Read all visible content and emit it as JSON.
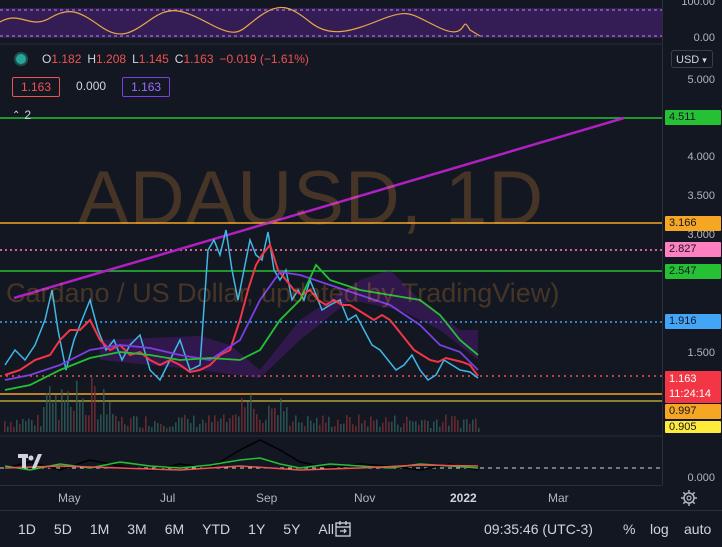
{
  "watermark": {
    "symbol": "ADAUSD, 1D",
    "description": "Cardano / US Dollar, updated by TradingView)"
  },
  "ohlc": {
    "open_label": "O",
    "open": "1.182",
    "high_label": "H",
    "high": "1.208",
    "low_label": "L",
    "low": "1.145",
    "close_label": "C",
    "close": "1.163",
    "change": "−0.019 (−1.61%)"
  },
  "indicator_boxes": [
    "1.163",
    "0.000",
    "1.163"
  ],
  "collapse": {
    "count": "2"
  },
  "currency": {
    "label": "USD"
  },
  "price_axis": {
    "ticks": [
      "5.000",
      "4.000",
      "3.500",
      "3.000",
      "1.500",
      "0.000"
    ],
    "osc_ticks": [
      "100.00",
      "0.00"
    ],
    "tags": {
      "t4511": "4.511",
      "t3166": "3.166",
      "t2827": "2.827",
      "t2547": "2.547",
      "t1916": "1.916",
      "t1163": "1.163",
      "countdown": "11:24:14",
      "t0997": "0.997",
      "t0905": "0.905"
    }
  },
  "date_axis": [
    "May",
    "Jul",
    "Sep",
    "Nov",
    "2022",
    "Mar"
  ],
  "ranges": [
    "1D",
    "5D",
    "1M",
    "3M",
    "6M",
    "YTD",
    "1Y",
    "5Y",
    "All"
  ],
  "footer": {
    "clock": "09:35:46 (UTC-3)",
    "percent": "%",
    "log": "log",
    "auto": "auto"
  },
  "logo": "TV",
  "colors": {
    "green": "#26c034",
    "orange": "#f5a623",
    "pink": "#ff80c0",
    "blue": "#42a5f5",
    "red": "#ef5350",
    "purple": "#9c27b0",
    "yellow": "#ffeb3b"
  }
}
